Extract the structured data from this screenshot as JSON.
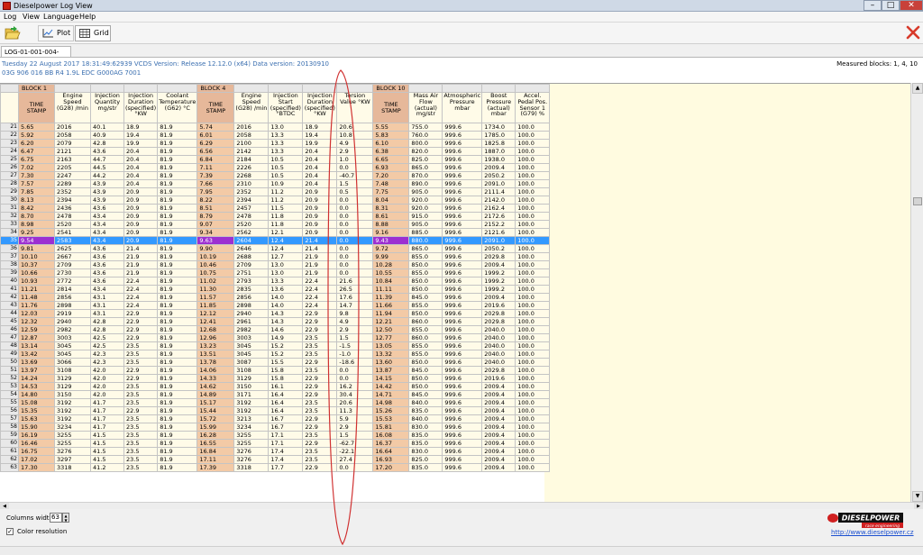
{
  "window": {
    "title": "Dieselpower Log View",
    "minimize": "–",
    "maximize": "□",
    "close": "✕"
  },
  "menu": [
    "Log",
    "View",
    "Language",
    "Help"
  ],
  "toolbar": {
    "open_icon": "folder-open-icon",
    "plot_label": "Plot",
    "grid_label": "Grid",
    "close_icon": "close-x-icon",
    "close_color": "#d83a2a"
  },
  "file_tab": "LOG-01-001-004-010.csv",
  "info": {
    "line1": "Tuesday 22 August 2017 18:31:49:62939 VCDS Version: Release 12.12.0 (x64) Data version: 20130910",
    "line2": "03G 906 016 BB  R4 1.9L EDC G000AG  7001",
    "measured_blocks": "Measured blocks: 1, 4, 10"
  },
  "grid": {
    "blocks": [
      "BLOCK 1",
      "BLOCK 4",
      "BLOCK 10"
    ],
    "headers": [
      "TIME STAMP",
      "Engine Speed (G28) /min",
      "Injection Quantity mg/str",
      "Injection Duration (specified) °KW",
      "Coolant Temperature (G62) °C",
      "TIME STAMP",
      "Engine Speed (G28) /min",
      "Injection Start (specified) °BTDC",
      "Injection Duration (specified) °KW",
      "Torsion Value °KW",
      "TIME STAMP",
      "Mass Air Flow (actual) mg/str",
      "Atmospheric Pressure mbar",
      "Boost Pressure (actual) mbar",
      "Accel. Pedal Pos. Sensor 1 (G79) %"
    ],
    "selected_row": 35,
    "rows": [
      [
        "21",
        "5.65",
        "2016",
        "40.1",
        "18.9",
        "81.9",
        "5.74",
        "2016",
        "13.0",
        "18.9",
        "20.6",
        "5.55",
        "755.0",
        "999.6",
        "1734.0",
        "100.0"
      ],
      [
        "22",
        "5.92",
        "2058",
        "40.9",
        "19.4",
        "81.9",
        "6.01",
        "2058",
        "13.3",
        "19.4",
        "10.8",
        "5.83",
        "760.0",
        "999.6",
        "1785.0",
        "100.0"
      ],
      [
        "23",
        "6.20",
        "2079",
        "42.8",
        "19.9",
        "81.9",
        "6.29",
        "2100",
        "13.3",
        "19.9",
        "4.9",
        "6.10",
        "800.0",
        "999.6",
        "1825.8",
        "100.0"
      ],
      [
        "24",
        "6.47",
        "2121",
        "43.6",
        "20.4",
        "81.9",
        "6.56",
        "2142",
        "13.3",
        "20.4",
        "2.9",
        "6.38",
        "820.0",
        "999.6",
        "1887.0",
        "100.0"
      ],
      [
        "25",
        "6.75",
        "2163",
        "44.7",
        "20.4",
        "81.9",
        "6.84",
        "2184",
        "10.5",
        "20.4",
        "1.0",
        "6.65",
        "825.0",
        "999.6",
        "1938.0",
        "100.0"
      ],
      [
        "26",
        "7.02",
        "2205",
        "44.5",
        "20.4",
        "81.9",
        "7.11",
        "2226",
        "10.5",
        "20.4",
        "0.0",
        "6.93",
        "865.0",
        "999.6",
        "2009.4",
        "100.0"
      ],
      [
        "27",
        "7.30",
        "2247",
        "44.2",
        "20.4",
        "81.9",
        "7.39",
        "2268",
        "10.5",
        "20.4",
        "-40.7",
        "7.20",
        "870.0",
        "999.6",
        "2050.2",
        "100.0"
      ],
      [
        "28",
        "7.57",
        "2289",
        "43.9",
        "20.4",
        "81.9",
        "7.66",
        "2310",
        "10.9",
        "20.4",
        "1.5",
        "7.48",
        "890.0",
        "999.6",
        "2091.0",
        "100.0"
      ],
      [
        "29",
        "7.85",
        "2352",
        "43.9",
        "20.9",
        "81.9",
        "7.95",
        "2352",
        "11.2",
        "20.9",
        "0.5",
        "7.75",
        "905.0",
        "999.6",
        "2111.4",
        "100.0"
      ],
      [
        "30",
        "8.13",
        "2394",
        "43.9",
        "20.9",
        "81.9",
        "8.22",
        "2394",
        "11.2",
        "20.9",
        "0.0",
        "8.04",
        "920.0",
        "999.6",
        "2142.0",
        "100.0"
      ],
      [
        "31",
        "8.42",
        "2436",
        "43.6",
        "20.9",
        "81.9",
        "8.51",
        "2457",
        "11.5",
        "20.9",
        "0.0",
        "8.31",
        "920.0",
        "999.6",
        "2162.4",
        "100.0"
      ],
      [
        "32",
        "8.70",
        "2478",
        "43.4",
        "20.9",
        "81.9",
        "8.79",
        "2478",
        "11.8",
        "20.9",
        "0.0",
        "8.61",
        "915.0",
        "999.6",
        "2172.6",
        "100.0"
      ],
      [
        "33",
        "8.98",
        "2520",
        "43.4",
        "20.9",
        "81.9",
        "9.07",
        "2520",
        "11.8",
        "20.9",
        "0.0",
        "8.88",
        "905.0",
        "999.6",
        "2152.2",
        "100.0"
      ],
      [
        "34",
        "9.25",
        "2541",
        "43.4",
        "20.9",
        "81.9",
        "9.34",
        "2562",
        "12.1",
        "20.9",
        "0.0",
        "9.16",
        "885.0",
        "999.6",
        "2121.6",
        "100.0"
      ],
      [
        "35",
        "9.54",
        "2583",
        "43.4",
        "20.9",
        "81.9",
        "9.63",
        "2604",
        "12.4",
        "21.4",
        "0.0",
        "9.43",
        "880.0",
        "999.6",
        "2091.0",
        "100.0"
      ],
      [
        "36",
        "9.81",
        "2625",
        "43.6",
        "21.4",
        "81.9",
        "9.90",
        "2646",
        "12.4",
        "21.4",
        "0.0",
        "9.72",
        "865.0",
        "999.6",
        "2050.2",
        "100.0"
      ],
      [
        "37",
        "10.10",
        "2667",
        "43.6",
        "21.9",
        "81.9",
        "10.19",
        "2688",
        "12.7",
        "21.9",
        "0.0",
        "9.99",
        "855.0",
        "999.6",
        "2029.8",
        "100.0"
      ],
      [
        "38",
        "10.37",
        "2709",
        "43.6",
        "21.9",
        "81.9",
        "10.46",
        "2709",
        "13.0",
        "21.9",
        "0.0",
        "10.28",
        "850.0",
        "999.6",
        "2009.4",
        "100.0"
      ],
      [
        "39",
        "10.66",
        "2730",
        "43.6",
        "21.9",
        "81.9",
        "10.75",
        "2751",
        "13.0",
        "21.9",
        "0.0",
        "10.55",
        "855.0",
        "999.6",
        "1999.2",
        "100.0"
      ],
      [
        "40",
        "10.93",
        "2772",
        "43.6",
        "22.4",
        "81.9",
        "11.02",
        "2793",
        "13.3",
        "22.4",
        "21.6",
        "10.84",
        "850.0",
        "999.6",
        "1999.2",
        "100.0"
      ],
      [
        "41",
        "11.21",
        "2814",
        "43.4",
        "22.4",
        "81.9",
        "11.30",
        "2835",
        "13.6",
        "22.4",
        "26.5",
        "11.11",
        "850.0",
        "999.6",
        "1999.2",
        "100.0"
      ],
      [
        "42",
        "11.48",
        "2856",
        "43.1",
        "22.4",
        "81.9",
        "11.57",
        "2856",
        "14.0",
        "22.4",
        "17.6",
        "11.39",
        "845.0",
        "999.6",
        "2009.4",
        "100.0"
      ],
      [
        "43",
        "11.76",
        "2898",
        "43.1",
        "22.4",
        "81.9",
        "11.85",
        "2898",
        "14.0",
        "22.4",
        "14.7",
        "11.66",
        "855.0",
        "999.6",
        "2019.6",
        "100.0"
      ],
      [
        "44",
        "12.03",
        "2919",
        "43.1",
        "22.9",
        "81.9",
        "12.12",
        "2940",
        "14.3",
        "22.9",
        "9.8",
        "11.94",
        "850.0",
        "999.6",
        "2029.8",
        "100.0"
      ],
      [
        "45",
        "12.32",
        "2940",
        "42.8",
        "22.9",
        "81.9",
        "12.41",
        "2961",
        "14.3",
        "22.9",
        "4.9",
        "12.21",
        "860.0",
        "999.6",
        "2029.8",
        "100.0"
      ],
      [
        "46",
        "12.59",
        "2982",
        "42.8",
        "22.9",
        "81.9",
        "12.68",
        "2982",
        "14.6",
        "22.9",
        "2.9",
        "12.50",
        "855.0",
        "999.6",
        "2040.0",
        "100.0"
      ],
      [
        "47",
        "12.87",
        "3003",
        "42.5",
        "22.9",
        "81.9",
        "12.96",
        "3003",
        "14.9",
        "23.5",
        "1.5",
        "12.77",
        "860.0",
        "999.6",
        "2040.0",
        "100.0"
      ],
      [
        "48",
        "13.14",
        "3045",
        "42.5",
        "23.5",
        "81.9",
        "13.23",
        "3045",
        "15.2",
        "23.5",
        "-1.5",
        "13.05",
        "855.0",
        "999.6",
        "2040.0",
        "100.0"
      ],
      [
        "49",
        "13.42",
        "3045",
        "42.3",
        "23.5",
        "81.9",
        "13.51",
        "3045",
        "15.2",
        "23.5",
        "-1.0",
        "13.32",
        "855.0",
        "999.6",
        "2040.0",
        "100.0"
      ],
      [
        "50",
        "13.69",
        "3066",
        "42.3",
        "23.5",
        "81.9",
        "13.78",
        "3087",
        "15.5",
        "22.9",
        "-18.6",
        "13.60",
        "850.0",
        "999.6",
        "2040.0",
        "100.0"
      ],
      [
        "51",
        "13.97",
        "3108",
        "42.0",
        "22.9",
        "81.9",
        "14.06",
        "3108",
        "15.8",
        "23.5",
        "0.0",
        "13.87",
        "845.0",
        "999.6",
        "2029.8",
        "100.0"
      ],
      [
        "52",
        "14.24",
        "3129",
        "42.0",
        "22.9",
        "81.9",
        "14.33",
        "3129",
        "15.8",
        "22.9",
        "0.0",
        "14.15",
        "850.0",
        "999.6",
        "2019.6",
        "100.0"
      ],
      [
        "53",
        "14.53",
        "3129",
        "42.0",
        "23.5",
        "81.9",
        "14.62",
        "3150",
        "16.1",
        "22.9",
        "16.2",
        "14.42",
        "850.0",
        "999.6",
        "2009.4",
        "100.0"
      ],
      [
        "54",
        "14.80",
        "3150",
        "42.0",
        "23.5",
        "81.9",
        "14.89",
        "3171",
        "16.4",
        "22.9",
        "30.4",
        "14.71",
        "845.0",
        "999.6",
        "2009.4",
        "100.0"
      ],
      [
        "55",
        "15.08",
        "3192",
        "41.7",
        "23.5",
        "81.9",
        "15.17",
        "3192",
        "16.4",
        "23.5",
        "20.6",
        "14.98",
        "840.0",
        "999.6",
        "2009.4",
        "100.0"
      ],
      [
        "56",
        "15.35",
        "3192",
        "41.7",
        "22.9",
        "81.9",
        "15.44",
        "3192",
        "16.4",
        "23.5",
        "11.3",
        "15.26",
        "835.0",
        "999.6",
        "2009.4",
        "100.0"
      ],
      [
        "57",
        "15.63",
        "3192",
        "41.7",
        "23.5",
        "81.9",
        "15.72",
        "3213",
        "16.7",
        "22.9",
        "5.9",
        "15.53",
        "840.0",
        "999.6",
        "2009.4",
        "100.0"
      ],
      [
        "58",
        "15.90",
        "3234",
        "41.7",
        "23.5",
        "81.9",
        "15.99",
        "3234",
        "16.7",
        "22.9",
        "2.9",
        "15.81",
        "830.0",
        "999.6",
        "2009.4",
        "100.0"
      ],
      [
        "59",
        "16.19",
        "3255",
        "41.5",
        "23.5",
        "81.9",
        "16.28",
        "3255",
        "17.1",
        "23.5",
        "1.5",
        "16.08",
        "835.0",
        "999.6",
        "2009.4",
        "100.0"
      ],
      [
        "60",
        "16.46",
        "3255",
        "41.5",
        "23.5",
        "81.9",
        "16.55",
        "3255",
        "17.1",
        "22.9",
        "-62.7",
        "16.37",
        "835.0",
        "999.6",
        "2009.4",
        "100.0"
      ],
      [
        "61",
        "16.75",
        "3276",
        "41.5",
        "23.5",
        "81.9",
        "16.84",
        "3276",
        "17.4",
        "23.5",
        "-22.1",
        "16.64",
        "830.0",
        "999.6",
        "2009.4",
        "100.0"
      ],
      [
        "62",
        "17.02",
        "3297",
        "41.5",
        "23.5",
        "81.9",
        "17.11",
        "3276",
        "17.4",
        "23.5",
        "27.4",
        "16.93",
        "825.0",
        "999.6",
        "2009.4",
        "100.0"
      ],
      [
        "63",
        "17.30",
        "3318",
        "41.2",
        "23.5",
        "81.9",
        "17.39",
        "3318",
        "17.7",
        "22.9",
        "0.0",
        "17.20",
        "835.0",
        "999.6",
        "2009.4",
        "100.0"
      ]
    ]
  },
  "bottom": {
    "columns_width_label": "Columns width:",
    "columns_width_value": "63",
    "color_resolution_label": "Color resolution",
    "color_resolution_checked": "✓",
    "logo_text": "DIESELPOWER",
    "logo_sub": "race engineering",
    "website": "http://www.dieselpower.cz"
  },
  "colors": {
    "selection": "#3399ff",
    "timestamp_selected": "#9c2fd1",
    "timestamp_cell": "#f3caa6",
    "cell_bg": "#fffbe8",
    "annotation": "#d03030"
  }
}
